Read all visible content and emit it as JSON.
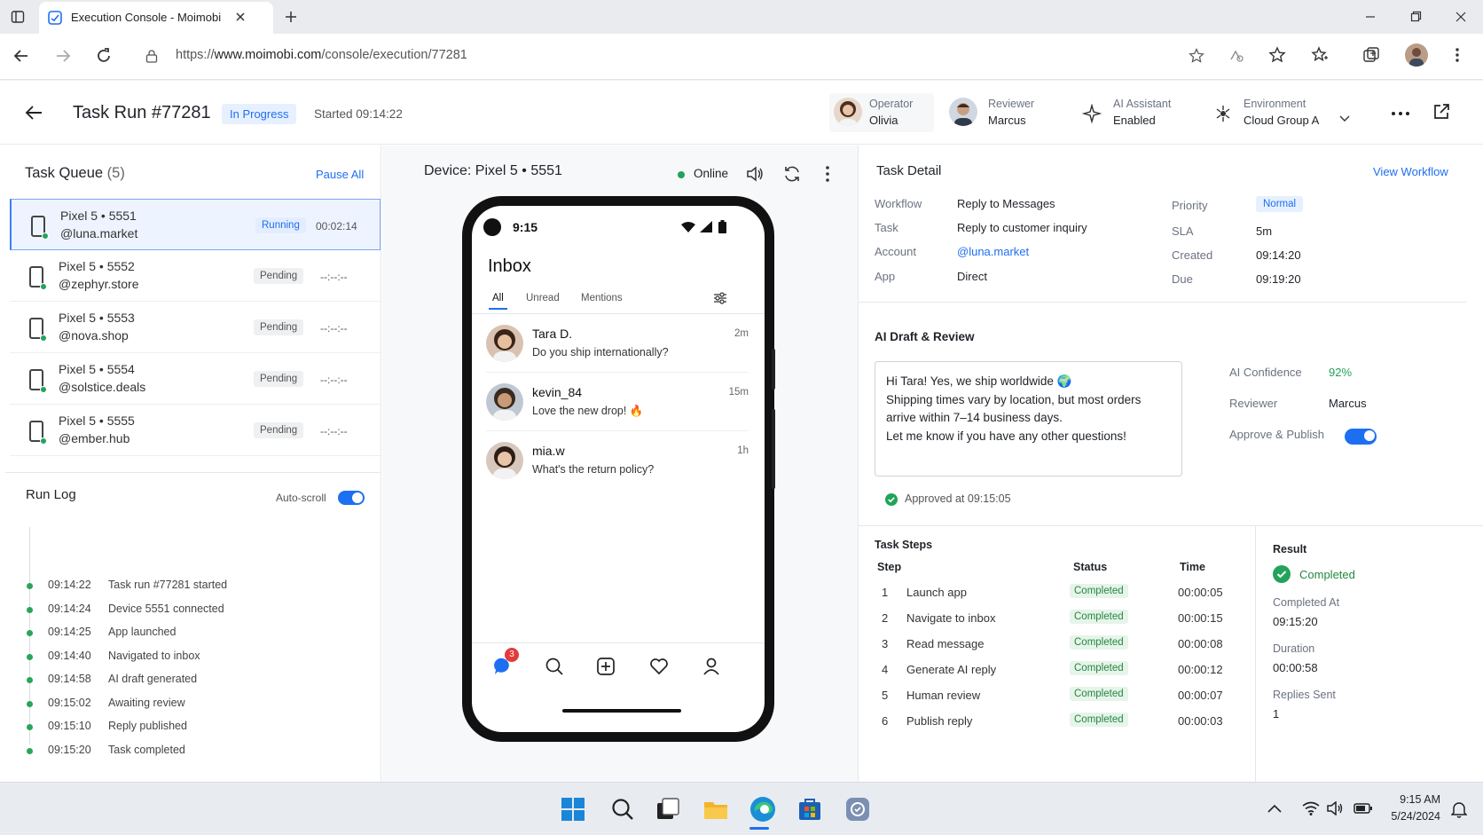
{
  "browser": {
    "tab_title": "Execution Console - Moimobi",
    "url_prefix": "https://",
    "url_domain": "www.moimobi.com",
    "url_path": "/console/execution/77281"
  },
  "header": {
    "title": "Task Run #77281",
    "status": "In Progress",
    "started": "Started 09:14:22",
    "operator_label": "Operator",
    "operator_value": "Olivia",
    "reviewer_label": "Reviewer",
    "reviewer_value": "Marcus",
    "ai_label": "AI Assistant",
    "ai_value": "Enabled",
    "env_label": "Environment",
    "env_value": "Cloud Group A"
  },
  "queue": {
    "title": "Task Queue",
    "count": "(5)",
    "pause_all": "Pause All",
    "items": [
      {
        "device": "Pixel 5 • 5551",
        "handle": "@luna.market",
        "status": "Running",
        "time": "00:02:14"
      },
      {
        "device": "Pixel 5 • 5552",
        "handle": "@zephyr.store",
        "status": "Pending",
        "time": "--:--:--"
      },
      {
        "device": "Pixel 5 • 5553",
        "handle": "@nova.shop",
        "status": "Pending",
        "time": "--:--:--"
      },
      {
        "device": "Pixel 5 • 5554",
        "handle": "@solstice.deals",
        "status": "Pending",
        "time": "--:--:--"
      },
      {
        "device": "Pixel 5 • 5555",
        "handle": "@ember.hub",
        "status": "Pending",
        "time": "--:--:--"
      }
    ]
  },
  "runlog": {
    "title": "Run Log",
    "autoscroll": "Auto-scroll",
    "entries": [
      {
        "time": "09:14:22",
        "text": "Task run #77281 started"
      },
      {
        "time": "09:14:24",
        "text": "Device 5551 connected"
      },
      {
        "time": "09:14:25",
        "text": "App launched"
      },
      {
        "time": "09:14:40",
        "text": "Navigated to inbox"
      },
      {
        "time": "09:14:58",
        "text": "AI draft generated"
      },
      {
        "time": "09:15:02",
        "text": "Awaiting review"
      },
      {
        "time": "09:15:10",
        "text": "Reply published"
      },
      {
        "time": "09:15:20",
        "text": "Task completed"
      }
    ]
  },
  "device": {
    "title": "Device: Pixel 5 • 5551",
    "status": "Online",
    "phone": {
      "time": "9:15",
      "inbox_title": "Inbox",
      "tabs": [
        "All",
        "Unread",
        "Mentions"
      ],
      "messages": [
        {
          "name": "Tara D.",
          "text": "Do you ship internationally?",
          "ago": "2m"
        },
        {
          "name": "kevin_84",
          "text": "Love the new drop! 🔥",
          "ago": "15m"
        },
        {
          "name": "mia.w",
          "text": "What's the return policy?",
          "ago": "1h"
        }
      ],
      "badge": "3"
    }
  },
  "detail": {
    "title": "Task Detail",
    "view_workflow": "View Workflow",
    "workflow_label": "Workflow",
    "workflow_value": "Reply to Messages",
    "task_label": "Task",
    "task_value": "Reply to customer inquiry",
    "account_label": "Account",
    "account_value": "@luna.market",
    "app_label": "App",
    "app_value": "Direct",
    "priority_label": "Priority",
    "priority_value": "Normal",
    "sla_label": "SLA",
    "sla_value": "5m",
    "created_label": "Created",
    "created_value": "09:14:20",
    "due_label": "Due",
    "due_value": "09:19:20"
  },
  "draft": {
    "title": "AI Draft & Review",
    "line1": "Hi Tara! Yes, we ship worldwide 🌍",
    "line2": "Shipping times vary by location, but most orders",
    "line3": "arrive within 7–14 business days.",
    "line4": "Let me know if you have any other questions!",
    "confidence_label": "AI Confidence",
    "confidence_value": "92%",
    "reviewer_label": "Reviewer",
    "reviewer_value": "Marcus",
    "approve_label": "Approve & Publish",
    "approved": "Approved at 09:15:05"
  },
  "steps": {
    "title": "Task Steps",
    "col_step": "Step",
    "col_status": "Status",
    "col_time": "Time",
    "rows": [
      {
        "n": "1",
        "step": "Launch app",
        "status": "Completed",
        "time": "00:00:05"
      },
      {
        "n": "2",
        "step": "Navigate to inbox",
        "status": "Completed",
        "time": "00:00:15"
      },
      {
        "n": "3",
        "step": "Read message",
        "status": "Completed",
        "time": "00:00:08"
      },
      {
        "n": "4",
        "step": "Generate AI reply",
        "status": "Completed",
        "time": "00:00:12"
      },
      {
        "n": "5",
        "step": "Human review",
        "status": "Completed",
        "time": "00:00:07"
      },
      {
        "n": "6",
        "step": "Publish reply",
        "status": "Completed",
        "time": "00:00:03"
      }
    ]
  },
  "result": {
    "title": "Result",
    "status": "Completed",
    "completed_at_label": "Completed At",
    "completed_at_value": "09:15:20",
    "duration_label": "Duration",
    "duration_value": "00:00:58",
    "replies_label": "Replies Sent",
    "replies_value": "1"
  },
  "taskbar": {
    "time": "9:15 AM",
    "date": "5/24/2024"
  },
  "colors": {
    "accent": "#1d6ff2",
    "success": "#22a35a",
    "pending_bg": "#eef0f2"
  }
}
